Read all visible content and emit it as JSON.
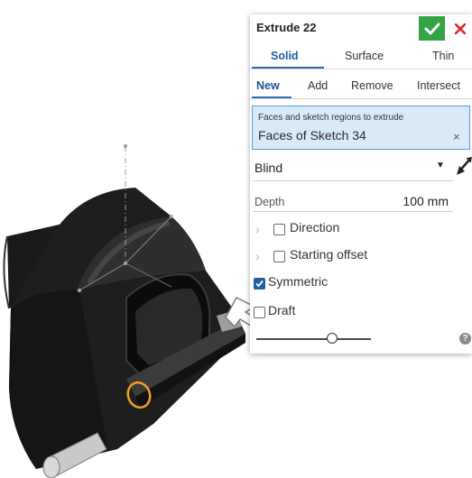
{
  "dialog": {
    "title": "Extrude 22",
    "body_types": [
      "Solid",
      "Surface",
      "Thin"
    ],
    "operations": [
      "New",
      "Add",
      "Remove",
      "Intersect"
    ],
    "faces_label": "Faces and sketch regions to extrude",
    "faces_value": "Faces of Sketch 34",
    "faces_clear": "×",
    "end_type": "Blind",
    "depth_label": "Depth",
    "depth_value": "100 mm",
    "direction_label": "Direction",
    "starting_offset_label": "Starting offset",
    "symmetric_label": "Symmetric",
    "draft_label": "Draft",
    "help_glyph": "?"
  },
  "state": {
    "body_type": "Solid",
    "operation": "New",
    "direction": false,
    "starting_offset": false,
    "symmetric": true,
    "draft": false
  },
  "colors": {
    "accent": "#1f5fa6",
    "ok_green": "#33a345",
    "cancel_red": "#d9282f",
    "selection_bg": "#d8e9f8",
    "part_body": "#1c1c1c",
    "highlight_orange": "#f0a020"
  },
  "icons": {
    "ok": "checkmark-icon",
    "cancel": "close-icon",
    "flip": "flip-direction-arrow-icon",
    "help": "help-icon",
    "expand": "chevron-right-icon"
  }
}
